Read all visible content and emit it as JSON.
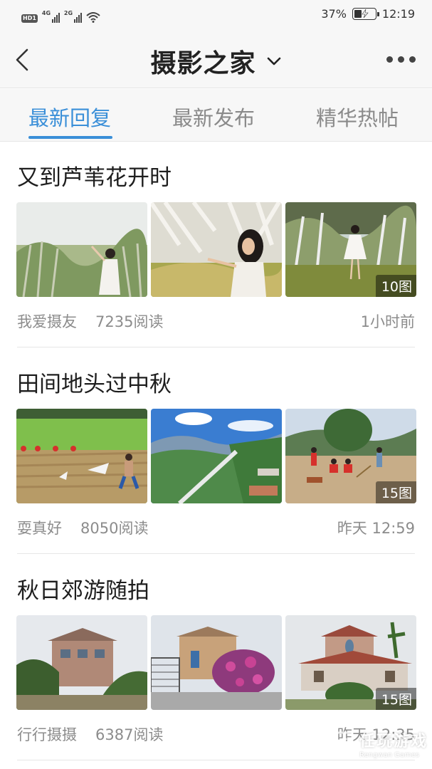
{
  "status_bar": {
    "hd_badge": "HD1",
    "net1": "4G",
    "net2": "2G",
    "battery_percent": "37%",
    "battery_level": 0.37,
    "time": "12:19"
  },
  "nav": {
    "title": "摄影之家",
    "back_icon": "chevron-left-icon",
    "dropdown_icon": "chevron-down-icon",
    "more_icon": "more-dots-icon"
  },
  "tabs": [
    {
      "label": "最新回复",
      "active": true
    },
    {
      "label": "最新发布",
      "active": false
    },
    {
      "label": "精华热帖",
      "active": false
    }
  ],
  "colors": {
    "accent": "#3a8fd8",
    "text_primary": "#1e1e1e",
    "text_secondary": "#8c8c8c",
    "bar_background": "#f7f7f7"
  },
  "posts": [
    {
      "title": "又到芦苇花开时",
      "author": "我爱摄友",
      "reads": "7235阅读",
      "time": "1小时前",
      "image_count": "10图",
      "thumbnails": [
        "reed-field-woman-photo",
        "reed-woman-closeup-photo",
        "woman-in-white-dress-photo"
      ]
    },
    {
      "title": "田间地头过中秋",
      "author": "耍真好",
      "reads": "8050阅读",
      "time": "昨天 12:59",
      "image_count": "15图",
      "thumbnails": [
        "rice-field-harvest-photo",
        "valley-highway-photo",
        "villagers-courtyard-photo"
      ]
    },
    {
      "title": "秋日郊游随拍",
      "author": "行行摄摄",
      "reads": "6387阅读",
      "time": "昨天 12:35",
      "image_count": "15图",
      "thumbnails": [
        "village-house-photo",
        "gate-flowers-house-photo",
        "red-roof-villa-photo"
      ]
    }
  ],
  "watermark": {
    "text_cn": "任玩游戏",
    "text_en": "Rengwan Games"
  }
}
